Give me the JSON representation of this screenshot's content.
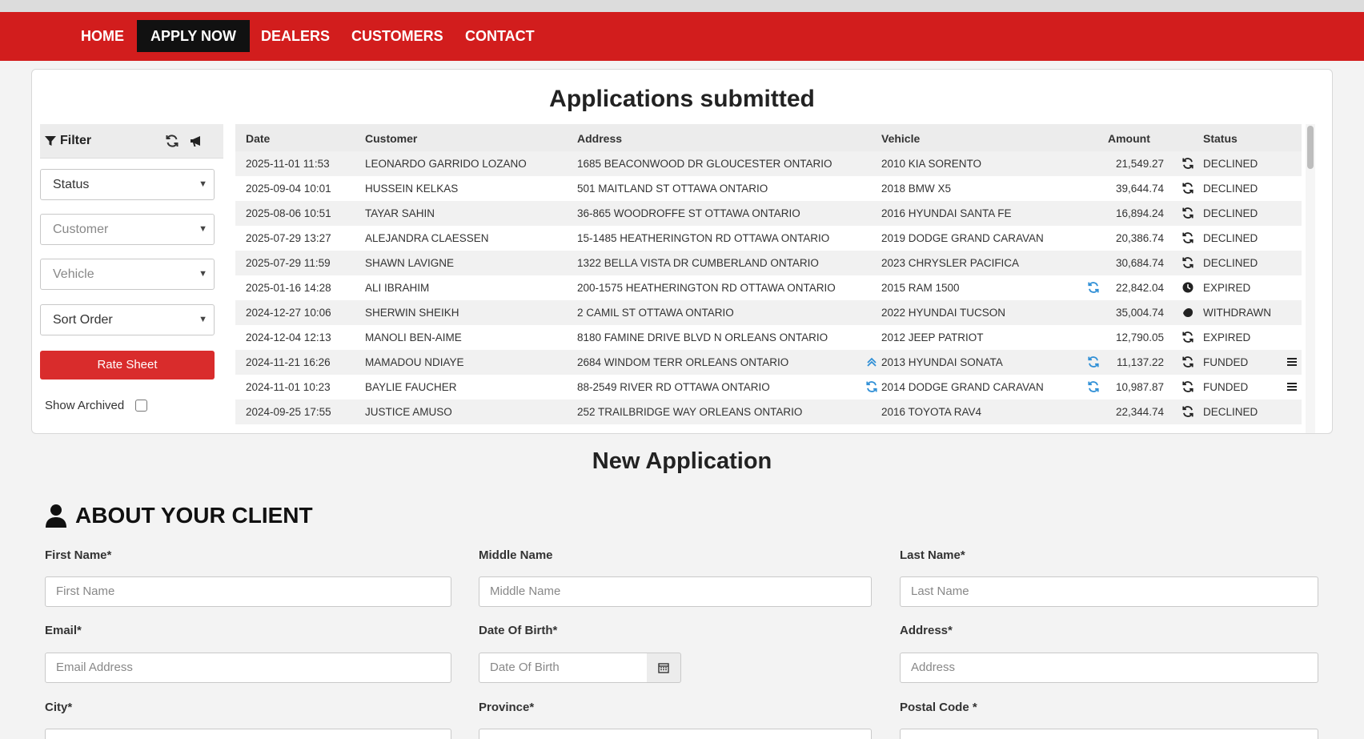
{
  "nav": {
    "items": [
      {
        "label": "HOME"
      },
      {
        "label": "APPLY NOW"
      },
      {
        "label": "DEALERS"
      },
      {
        "label": "CUSTOMERS"
      },
      {
        "label": "CONTACT"
      }
    ],
    "active": "APPLY NOW"
  },
  "applications": {
    "title": "Applications submitted",
    "filter": {
      "title": "Filter",
      "status_select": "Status",
      "customer_select": "Customer",
      "vehicle_select": "Vehicle",
      "sort_select": "Sort Order",
      "rate_sheet_label": "Rate Sheet",
      "show_archived_label": "Show Archived"
    },
    "columns": {
      "date": "Date",
      "customer": "Customer",
      "address": "Address",
      "vehicle": "Vehicle",
      "amount": "Amount",
      "status": "Status"
    },
    "rows": [
      {
        "date": "2025-11-01 11:53",
        "customer": "LEONARDO GARRIDO LOZANO",
        "address": "1685 BEACONWOOD DR GLOUCESTER ONTARIO",
        "vehicle": "2010 KIA SORENTO",
        "amount": "21,549.27",
        "status": "DECLINED"
      },
      {
        "date": "2025-09-04 10:01",
        "customer": "HUSSEIN KELKAS",
        "address": "501 MAITLAND ST OTTAWA ONTARIO",
        "vehicle": "2018 BMW X5",
        "amount": "39,644.74",
        "status": "DECLINED"
      },
      {
        "date": "2025-08-06 10:51",
        "customer": "TAYAR SAHIN",
        "address": "36-865 WOODROFFE ST OTTAWA ONTARIO",
        "vehicle": "2016 HYUNDAI SANTA FE",
        "amount": "16,894.24",
        "status": "DECLINED"
      },
      {
        "date": "2025-07-29 13:27",
        "customer": "ALEJANDRA CLAESSEN",
        "address": "15-1485 HEATHERINGTON RD OTTAWA ONTARIO",
        "vehicle": "2019 DODGE GRAND CARAVAN",
        "amount": "20,386.74",
        "status": "DECLINED"
      },
      {
        "date": "2025-07-29 11:59",
        "customer": "SHAWN LAVIGNE",
        "address": "1322 BELLA VISTA DR CUMBERLAND ONTARIO",
        "vehicle": "2023 CHRYSLER PACIFICA",
        "amount": "30,684.74",
        "status": "DECLINED"
      },
      {
        "date": "2025-01-16 14:28",
        "customer": "ALI IBRAHIM",
        "address": "200-1575 HEATHERINGTON RD OTTAWA ONTARIO",
        "vehicle": "2015 RAM 1500",
        "amount": "22,842.04",
        "status": "EXPIRED"
      },
      {
        "date": "2024-12-27 10:06",
        "customer": "SHERWIN SHEIKH",
        "address": "2 CAMIL ST OTTAWA ONTARIO",
        "vehicle": "2022 HYUNDAI TUCSON",
        "amount": "35,004.74",
        "status": "WITHDRAWN"
      },
      {
        "date": "2024-12-04 12:13",
        "customer": "MANOLI BEN-AIME",
        "address": "8180 FAMINE DRIVE BLVD N ORLEANS ONTARIO",
        "vehicle": "2012 JEEP PATRIOT",
        "amount": "12,790.05",
        "status": "EXPIRED"
      },
      {
        "date": "2024-11-21 16:26",
        "customer": "MAMADOU NDIAYE",
        "address": "2684 WINDOM TERR ORLEANS ONTARIO",
        "vehicle": "2013 HYUNDAI SONATA",
        "amount": "11,137.22",
        "status": "FUNDED"
      },
      {
        "date": "2024-11-01 10:23",
        "customer": "BAYLIE FAUCHER",
        "address": "88-2549 RIVER RD OTTAWA ONTARIO",
        "vehicle": "2014 DODGE GRAND CARAVAN",
        "amount": "10,987.87",
        "status": "FUNDED"
      },
      {
        "date": "2024-09-25 17:55",
        "customer": "JUSTICE AMUSO",
        "address": "252 TRAILBRIDGE WAY ORLEANS ONTARIO",
        "vehicle": "2016 TOYOTA RAV4",
        "amount": "22,344.74",
        "status": "DECLINED"
      }
    ]
  },
  "new_application": {
    "title": "New Application",
    "section_title": "ABOUT YOUR CLIENT",
    "fields": {
      "first_name": {
        "label": "First Name*",
        "placeholder": "First Name"
      },
      "middle_name": {
        "label": "Middle Name",
        "placeholder": "Middle Name"
      },
      "last_name": {
        "label": "Last Name*",
        "placeholder": "Last Name"
      },
      "email": {
        "label": "Email*",
        "placeholder": "Email Address"
      },
      "dob": {
        "label": "Date Of Birth*",
        "placeholder": "Date Of Birth"
      },
      "address": {
        "label": "Address*",
        "placeholder": "Address"
      },
      "city": {
        "label": "City*"
      },
      "province": {
        "label": "Province*"
      },
      "postal": {
        "label": "Postal Code *"
      }
    }
  },
  "colors": {
    "brand_red": "#d21d1d",
    "active_nav": "#111111",
    "button_red": "#d92c2c",
    "icon_blue": "#2f8fd6"
  }
}
